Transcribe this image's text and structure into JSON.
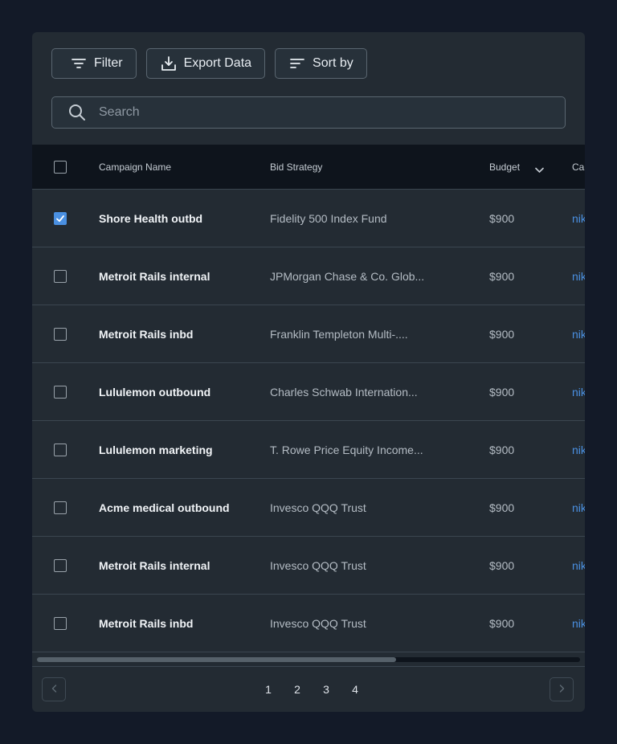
{
  "toolbar": {
    "filter_label": "Filter",
    "export_label": "Export Data",
    "sort_label": "Sort by"
  },
  "search": {
    "placeholder": "Search",
    "value": ""
  },
  "table": {
    "columns": {
      "name": "Campaign Name",
      "bid": "Bid Strategy",
      "budget": "Budget",
      "campaign": "Ca"
    },
    "rows": [
      {
        "checked": true,
        "name": "Shore Health outbd",
        "bid": "Fidelity 500 Index Fund",
        "budget": "$900",
        "link": "nik"
      },
      {
        "checked": false,
        "name": "Metroit Rails internal",
        "bid": "JPMorgan Chase & Co. Glob...",
        "budget": "$900",
        "link": "nik"
      },
      {
        "checked": false,
        "name": "Metroit Rails inbd",
        "bid": "Franklin Templeton Multi-....",
        "budget": "$900",
        "link": "nik"
      },
      {
        "checked": false,
        "name": "Lululemon outbound",
        "bid": "Charles Schwab Internation...",
        "budget": "$900",
        "link": "nik"
      },
      {
        "checked": false,
        "name": "Lululemon marketing",
        "bid": "T. Rowe Price Equity Income...",
        "budget": "$900",
        "link": "nik"
      },
      {
        "checked": false,
        "name": "Acme medical outbound",
        "bid": "Invesco QQQ Trust",
        "budget": "$900",
        "link": "nik"
      },
      {
        "checked": false,
        "name": "Metroit Rails internal",
        "bid": "Invesco QQQ Trust",
        "budget": "$900",
        "link": "nik"
      },
      {
        "checked": false,
        "name": "Metroit Rails inbd",
        "bid": "Invesco QQQ Trust",
        "budget": "$900",
        "link": "nik"
      }
    ]
  },
  "pagination": {
    "pages": [
      "1",
      "2",
      "3",
      "4"
    ]
  },
  "colors": {
    "background": "#131a28",
    "card": "#232b33",
    "accent": "#4a90e2"
  }
}
